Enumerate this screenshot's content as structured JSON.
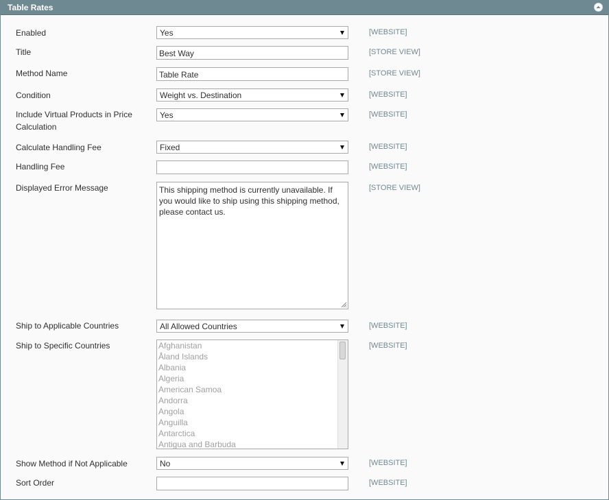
{
  "panel": {
    "title": "Table Rates",
    "collapse_icon": "chevron-up-icon"
  },
  "fields": {
    "enabled": {
      "label": "Enabled",
      "value": "Yes",
      "scope": "[WEBSITE]"
    },
    "title": {
      "label": "Title",
      "value": "Best Way",
      "scope": "[STORE VIEW]"
    },
    "method_name": {
      "label": "Method Name",
      "value": "Table Rate",
      "scope": "[STORE VIEW]"
    },
    "condition": {
      "label": "Condition",
      "value": "Weight vs. Destination",
      "scope": "[WEBSITE]"
    },
    "include_virtual": {
      "label": "Include Virtual Products in Price Calculation",
      "value": "Yes",
      "scope": "[WEBSITE]"
    },
    "calc_handling_fee": {
      "label": "Calculate Handling Fee",
      "value": "Fixed",
      "scope": "[WEBSITE]"
    },
    "handling_fee": {
      "label": "Handling Fee",
      "value": "",
      "scope": "[WEBSITE]"
    },
    "error_message": {
      "label": "Displayed Error Message",
      "value": "This shipping method is currently unavailable. If you would like to ship using this shipping method, please contact us.",
      "scope": "[STORE VIEW]"
    },
    "ship_applicable": {
      "label": "Ship to Applicable Countries",
      "value": "All Allowed Countries",
      "scope": "[WEBSITE]"
    },
    "ship_specific": {
      "label": "Ship to Specific Countries",
      "scope": "[WEBSITE]",
      "options": [
        "Afghanistan",
        "Åland Islands",
        "Albania",
        "Algeria",
        "American Samoa",
        "Andorra",
        "Angola",
        "Anguilla",
        "Antarctica",
        "Antigua and Barbuda"
      ]
    },
    "show_method": {
      "label": "Show Method if Not Applicable",
      "value": "No",
      "scope": "[WEBSITE]"
    },
    "sort_order": {
      "label": "Sort Order",
      "value": "",
      "scope": "[WEBSITE]"
    }
  }
}
